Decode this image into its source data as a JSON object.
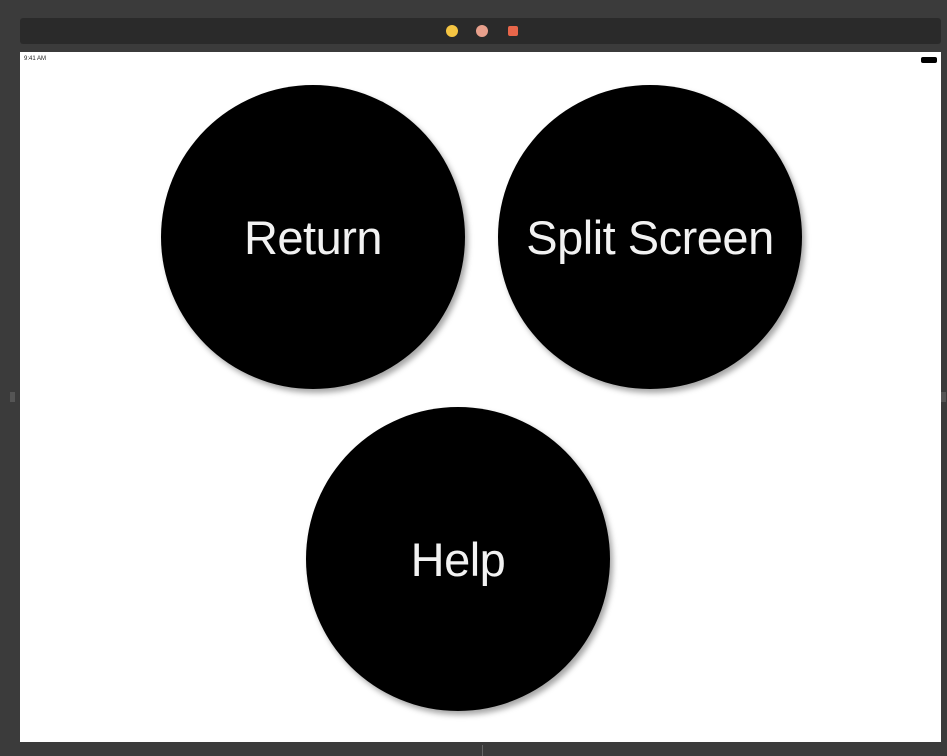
{
  "status_bar": {
    "time": "9:41 AM"
  },
  "window_controls": {
    "dot1_color": "#f5c542",
    "dot2_color": "#e8a08c",
    "dot3_color": "#e8664a"
  },
  "buttons": {
    "return_label": "Return",
    "split_screen_label": "Split Screen",
    "help_label": "Help"
  },
  "colors": {
    "button_bg": "#000000",
    "button_text": "#f2f2f2",
    "screen_bg": "#ffffff"
  }
}
